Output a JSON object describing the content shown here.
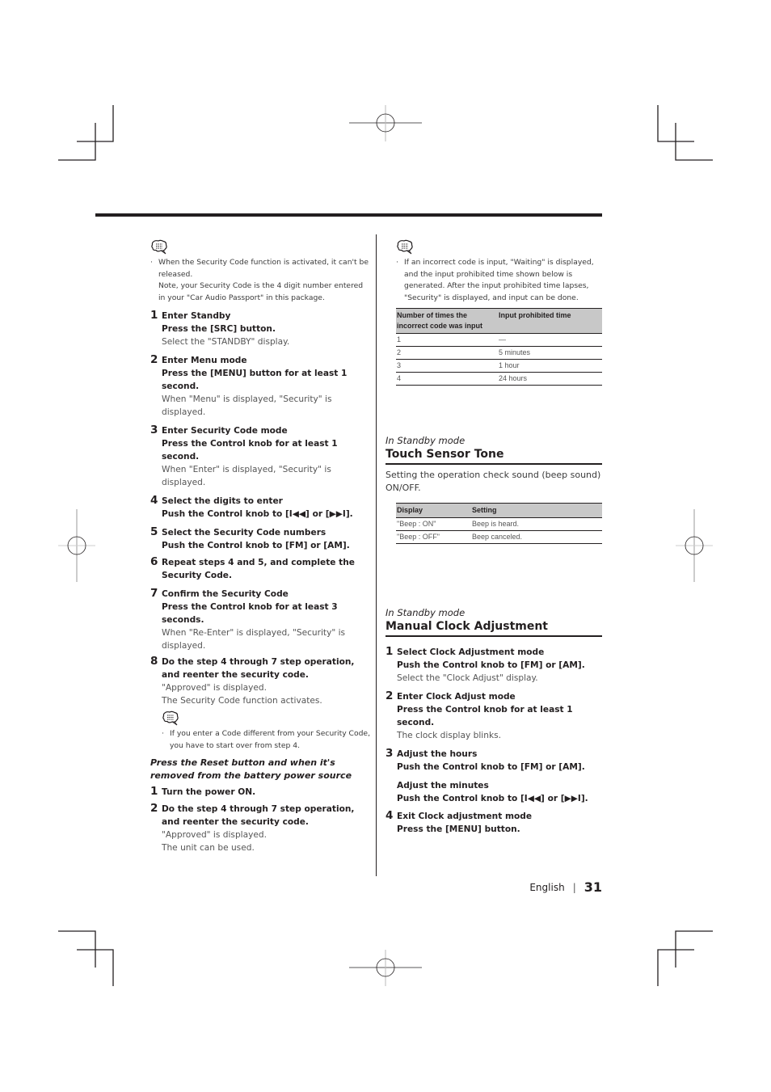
{
  "left_column": {
    "intro_note": {
      "icon": "memo-icon",
      "lines": [
        "When the Security Code function is activated, it can't be released.",
        "Note, your Security Code is the 4 digit number entered in your \"Car Audio Passport\" in this package."
      ]
    },
    "steps": [
      {
        "num": "1",
        "title": "Enter Standby",
        "action": "Press the [SRC] button.",
        "desc": "Select the \"STANDBY\" display."
      },
      {
        "num": "2",
        "title": "Enter Menu mode",
        "action": "Press the [MENU] button for at least 1 second.",
        "desc": "When \"Menu\" is displayed, \"Security\" is displayed."
      },
      {
        "num": "3",
        "title": "Enter Security Code mode",
        "action": "Press the Control knob for at least 1 second.",
        "desc": "When \"Enter\" is displayed, \"Security\" is displayed."
      },
      {
        "num": "4",
        "title": "Select the digits to enter",
        "action": "Push the Control knob to [I◀◀] or [▶▶I].",
        "desc": ""
      },
      {
        "num": "5",
        "title": "Select the Security Code numbers",
        "action": "Push the Control knob to [FM] or [AM].",
        "desc": ""
      },
      {
        "num": "6",
        "title": "Repeat steps 4 and 5, and complete the Security Code.",
        "action": "",
        "desc": ""
      },
      {
        "num": "7",
        "title": "Confirm the Security Code",
        "action": "Press the Control knob for at least 3 seconds.",
        "desc": "When \"Re-Enter\" is displayed, \"Security\" is displayed."
      },
      {
        "num": "8",
        "title": "Do the step 4 through 7 step operation, and reenter the security code.",
        "action": "",
        "desc1": "\"Approved\" is displayed.",
        "desc2": "The Security Code function activates."
      }
    ],
    "step8_note": {
      "icon": "memo-icon",
      "text": "If you enter a Code different from your Security Code, you have to start over from step 4."
    },
    "reset_heading": "Press the Reset button and when it's removed from the battery power source",
    "reset_steps": [
      {
        "num": "1",
        "title": "Turn the power ON."
      },
      {
        "num": "2",
        "title": "Do the step 4 through 7 step operation, and reenter the security code.",
        "desc1": "\"Approved\" is displayed.",
        "desc2": "The unit can be used."
      }
    ]
  },
  "right_column": {
    "note": {
      "icon": "memo-icon",
      "text": "If an incorrect code is input, \"Waiting\" is displayed, and the input prohibited time shown below is generated. After the input prohibited time lapses, \"Security\" is displayed, and input can be done."
    },
    "prohibit_table": {
      "headers": [
        "Number of times the incorrect code was input",
        "Input prohibited time"
      ],
      "rows": [
        [
          "1",
          "—"
        ],
        [
          "2",
          "5 minutes"
        ],
        [
          "3",
          "1 hour"
        ],
        [
          "4",
          "24 hours"
        ]
      ]
    },
    "touch_sensor": {
      "mode": "In Standby mode",
      "title": "Touch Sensor Tone",
      "description": "Setting the operation check sound (beep sound) ON/OFF.",
      "table": {
        "headers": [
          "Display",
          "Setting"
        ],
        "rows": [
          [
            "\"Beep : ON\"",
            "Beep is heard."
          ],
          [
            "\"Beep : OFF\"",
            "Beep canceled."
          ]
        ]
      }
    },
    "clock": {
      "mode": "In Standby mode",
      "title": "Manual Clock Adjustment",
      "steps": [
        {
          "num": "1",
          "title": "Select Clock Adjustment mode",
          "action": "Push the Control knob to [FM] or [AM].",
          "desc": "Select the \"Clock Adjust\" display."
        },
        {
          "num": "2",
          "title": "Enter Clock Adjust mode",
          "action": "Press the Control knob for at least 1 second.",
          "desc": "The clock display blinks."
        },
        {
          "num": "3",
          "title": "Adjust the hours",
          "action": "Push the Control knob to [FM] or [AM].",
          "sub_title": "Adjust the minutes",
          "sub_action": "Push the Control knob to [I◀◀] or [▶▶I]."
        },
        {
          "num": "4",
          "title": "Exit Clock adjustment mode",
          "action": "Press the [MENU] button."
        }
      ]
    }
  },
  "footer": {
    "language": "English",
    "separator": "|",
    "page_number": "31"
  }
}
